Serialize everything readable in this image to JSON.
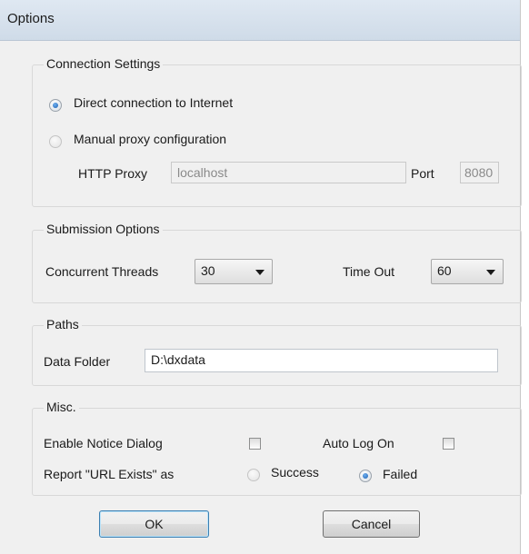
{
  "window": {
    "title": "Options"
  },
  "connection": {
    "group_label": "Connection Settings",
    "direct_label": "Direct connection to Internet",
    "manual_label": "Manual proxy configuration",
    "selected": "direct",
    "http_proxy_label": "HTTP Proxy",
    "http_proxy_value": "localhost",
    "port_label": "Port",
    "port_value": "8080"
  },
  "submission": {
    "group_label": "Submission Options",
    "threads_label": "Concurrent Threads",
    "threads_value": "30",
    "timeout_label": "Time Out",
    "timeout_value": "60"
  },
  "paths": {
    "group_label": "Paths",
    "data_folder_label": "Data Folder",
    "data_folder_value": "D:\\dxdata"
  },
  "misc": {
    "group_label": "Misc.",
    "enable_notice_label": "Enable Notice Dialog",
    "enable_notice_checked": false,
    "auto_logon_label": "Auto Log On",
    "auto_logon_checked": false,
    "report_label": "Report \"URL Exists\" as",
    "success_label": "Success",
    "failed_label": "Failed",
    "report_selected": "failed"
  },
  "buttons": {
    "ok_label": "OK",
    "cancel_label": "Cancel"
  }
}
